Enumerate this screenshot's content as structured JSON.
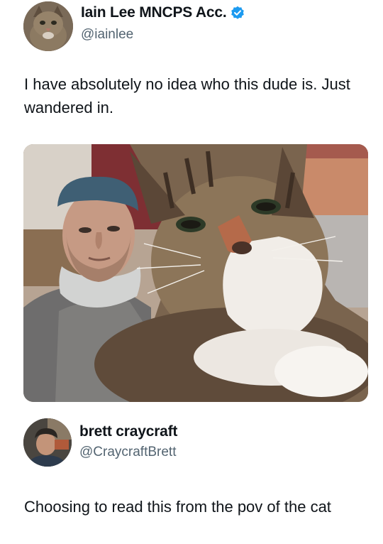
{
  "post1": {
    "author_name": "Iain Lee MNCPS Acc.",
    "handle": "@iainlee",
    "text": "I have absolutely no idea who this dude is. Just wandered in.",
    "verified_color": "#1d9bf0",
    "avatar_icon": "cat-avatar-icon",
    "media": "photo-man-and-tabby-cat"
  },
  "post2": {
    "author_name": "brett craycraft",
    "handle": "@CraycraftBrett",
    "text": "Choosing to read this from the pov of the cat",
    "avatar_icon": "person-avatar-icon"
  }
}
